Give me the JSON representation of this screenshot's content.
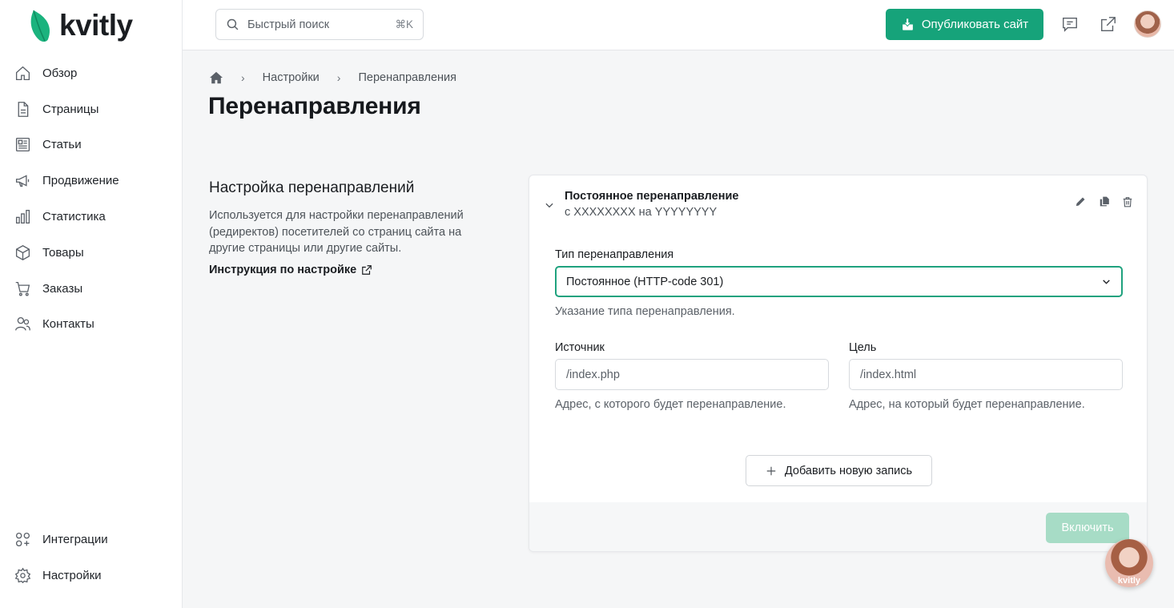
{
  "brand": {
    "name": "kvitly",
    "accent": "#16a37a"
  },
  "sidebar": {
    "items": [
      {
        "label": "Обзор",
        "icon": "home-icon"
      },
      {
        "label": "Страницы",
        "icon": "file-icon"
      },
      {
        "label": "Статьи",
        "icon": "newspaper-icon"
      },
      {
        "label": "Продвижение",
        "icon": "megaphone-icon"
      },
      {
        "label": "Статистика",
        "icon": "bar-chart-icon"
      },
      {
        "label": "Товары",
        "icon": "box-icon"
      },
      {
        "label": "Заказы",
        "icon": "cart-icon"
      },
      {
        "label": "Контакты",
        "icon": "users-icon"
      }
    ],
    "bottom_items": [
      {
        "label": "Интеграции",
        "icon": "apps-icon"
      },
      {
        "label": "Настройки",
        "icon": "gear-icon"
      }
    ]
  },
  "header": {
    "search": {
      "placeholder": "Быстрый поиск",
      "shortcut": "⌘K"
    },
    "publish_label": "Опубликовать сайт"
  },
  "breadcrumb": [
    "Настройки",
    "Перенаправления"
  ],
  "page": {
    "title": "Перенаправления"
  },
  "section": {
    "title": "Настройка перенаправлений",
    "description": "Используется для настройки перенаправлений (редиректов) посетителей со страниц сайта на другие страницы или другие сайты.",
    "link": "Инструкция по настройке"
  },
  "redirect": {
    "title": "Постоянное перенаправление",
    "subtitle": "с XXXXXXXX на YYYYYYYY",
    "type_label": "Тип перенаправления",
    "type_value": "Постоянное (HTTP-code 301)",
    "type_help": "Указание типа перенаправления.",
    "source_label": "Источник",
    "source_placeholder": "/index.php",
    "source_help": "Адрес, с которого будет перенаправление.",
    "target_label": "Цель",
    "target_placeholder": "/index.html",
    "target_help": "Адрес, на который будет перенаправление.",
    "add_label": "Добавить новую запись",
    "enable_label": "Включить"
  },
  "chat": {
    "label": "kvitly"
  }
}
